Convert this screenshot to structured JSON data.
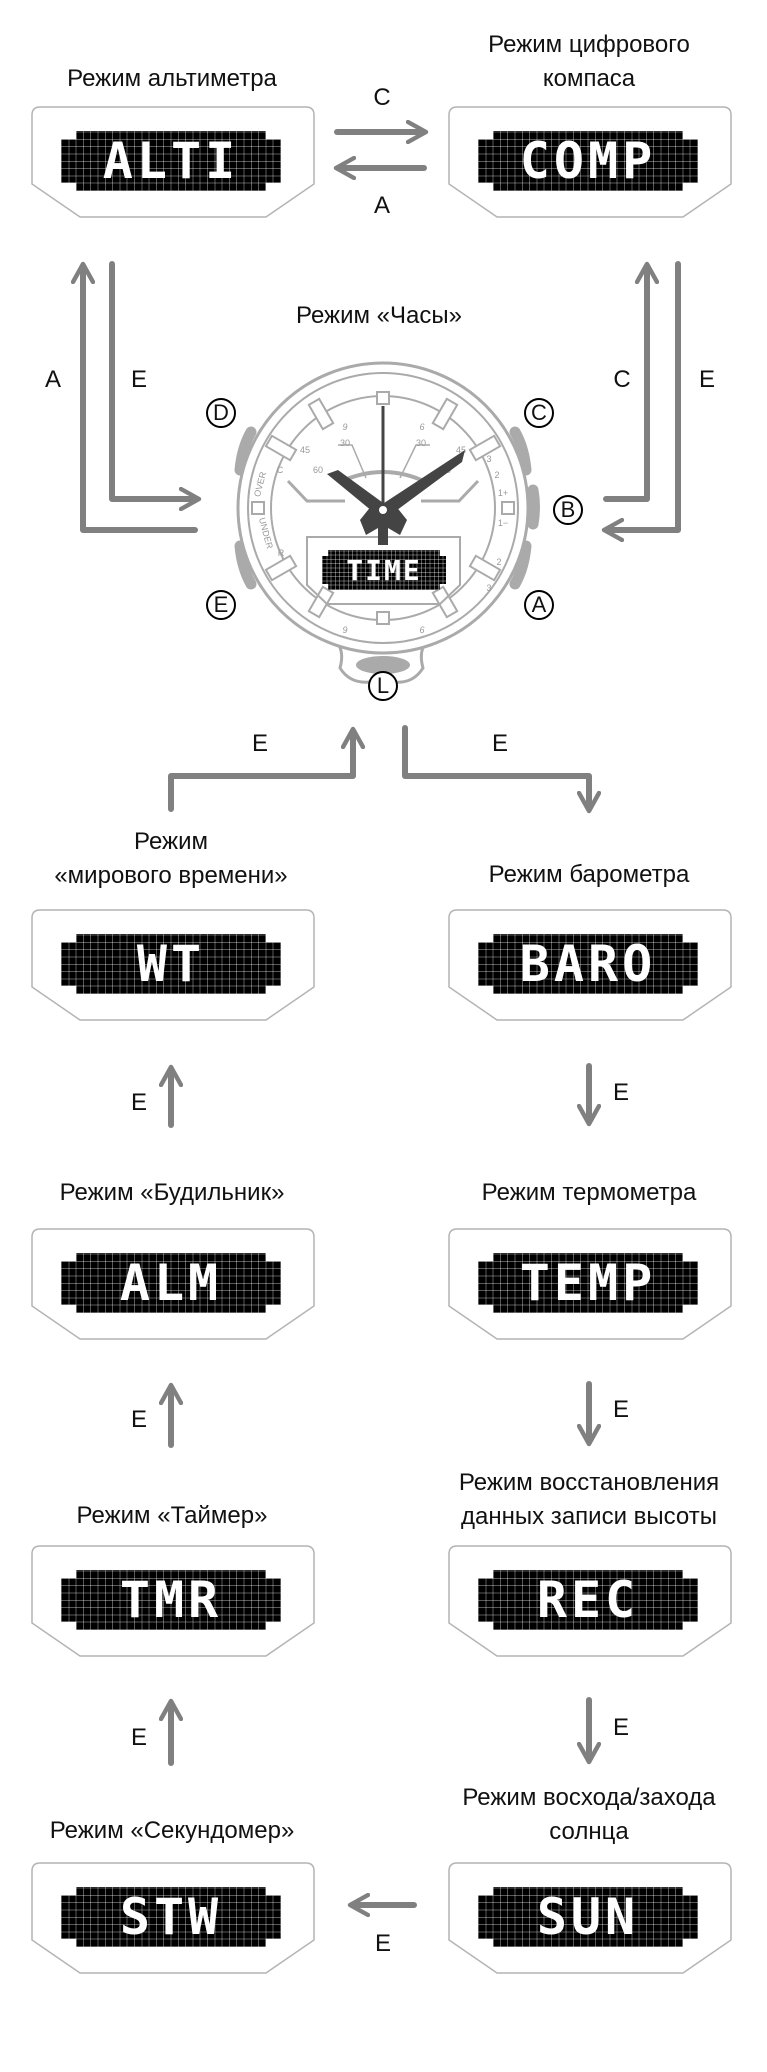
{
  "modes": [
    {
      "id": "alti",
      "title": [
        "Режим альтиметра"
      ],
      "lcd": "ALTI"
    },
    {
      "id": "comp",
      "title": [
        "Режим цифрового",
        "компаса"
      ],
      "lcd": "COMP"
    },
    {
      "id": "wt",
      "title": [
        "Режим",
        "«мирового времени»"
      ],
      "lcd": "WT"
    },
    {
      "id": "baro",
      "title": [
        "Режим барометра"
      ],
      "lcd": "BARO"
    },
    {
      "id": "alm",
      "title": [
        "Режим «Будильник»"
      ],
      "lcd": "ALM"
    },
    {
      "id": "temp",
      "title": [
        "Режим термометра"
      ],
      "lcd": "TEMP"
    },
    {
      "id": "tmr",
      "title": [
        "Режим «Таймер»"
      ],
      "lcd": "TMR"
    },
    {
      "id": "rec",
      "title": [
        "Режим восстановления",
        "данных записи высоты"
      ],
      "lcd": "REC"
    },
    {
      "id": "stw",
      "title": [
        "Режим «Секундомер»"
      ],
      "lcd": "STW"
    },
    {
      "id": "sun",
      "title": [
        "Режим восхода/захода",
        "солнца"
      ],
      "lcd": "SUN"
    }
  ],
  "timekeeping": {
    "title": "Режим «Часы»",
    "lcd": "TIME"
  },
  "arrow_labels": {
    "alti_to_comp": "C",
    "comp_to_alti": "A",
    "time_to_alti": "A",
    "alti_to_time": "E",
    "time_to_comp": "C",
    "comp_to_time": "E",
    "wt_to_time": "E",
    "time_to_baro": "E",
    "alm_to_wt": "E",
    "baro_to_temp": "E",
    "tmr_to_alm": "E",
    "temp_to_rec": "E",
    "stw_to_tmr": "E",
    "rec_to_sun": "E",
    "sun_to_stw": "E"
  },
  "watch_buttons": {
    "d": "D",
    "c": "C",
    "b": "B",
    "e": "E",
    "a": "A",
    "l": "L"
  },
  "dial_labels": {
    "top_left": "9",
    "top_right": "6",
    "left45": "45",
    "right45": "45",
    "left30": "30",
    "right30": "30",
    "left60": "60",
    "right60": "60",
    "c": "C",
    "over": "OVER",
    "under": "UNDER",
    "r": "R",
    "r3top": "3",
    "r2top": "2",
    "r1plus": "1+",
    "r1minus": "1−",
    "r2bot": "2",
    "r3bot": "3",
    "bottom_left": "9",
    "bottom_right": "6"
  },
  "colors": {
    "arrow": "#808080",
    "frame": "#b4b4b4",
    "lcd": "#000000",
    "hands": "#444444",
    "watch_line": "#aaaaaa"
  }
}
